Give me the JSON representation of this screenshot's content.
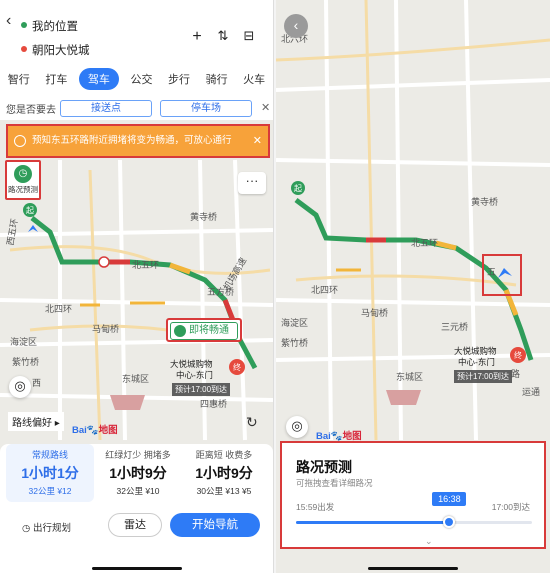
{
  "left": {
    "origin": "我的位置",
    "destination": "朝阳大悦城",
    "toolbar_icons": [
      "plus-icon",
      "swap-icon",
      "more-icon"
    ],
    "modes": [
      {
        "label": "智行",
        "active": false
      },
      {
        "label": "打车",
        "active": false
      },
      {
        "label": "驾车",
        "active": true
      },
      {
        "label": "公交",
        "active": false
      },
      {
        "label": "步行",
        "active": false
      },
      {
        "label": "骑行",
        "active": false
      },
      {
        "label": "火车",
        "active": false
      }
    ],
    "where_prompt": "您是否要去",
    "chip_pickup": "接送点",
    "chip_parking": "停车场",
    "notice": "预知东五环路附近拥堵将变为畅通，可放心通行",
    "forecast_button": "路况预测",
    "more_button": "···",
    "smooth_tag": "即将畅通",
    "eta": "预计17:00到达",
    "route_pref": "路线偏好 ▸",
    "routes": [
      {
        "tag": "常规路线",
        "time": "1小时1分",
        "sub": "32公里 ¥12",
        "selected": true
      },
      {
        "tag": "红绿灯少  拥堵多",
        "time": "1小时9分",
        "sub": "32公里 ¥10",
        "selected": false
      },
      {
        "tag": "距离短  收费多",
        "time": "1小时9分",
        "sub": "30公里 ¥13 ¥5",
        "selected": false
      }
    ],
    "plan_label": "出行规划",
    "radar_label": "雷达",
    "nav_label": "开始导航",
    "map_labels": {
      "huangsi": "黄寺桥",
      "beiwuhuan": "北五环",
      "beisihuan": "北四环",
      "maweiqiao": "马甸桥",
      "haidian": "海淀区",
      "zizhu": "紫竹桥",
      "dongcheng": "东城区",
      "jichang": "机场高速",
      "wufang": "五方桥",
      "sihui": "四惠桥",
      "mall1": "大悦城购物",
      "mall2": "中心-东门",
      "start": "起",
      "end": "终",
      "xi": "西",
      "xiwuhuan": "西五环"
    }
  },
  "right": {
    "map_labels": {
      "beiliuhuan": "北六环",
      "beiwuhuan": "北五环",
      "beisihuan": "北四环",
      "huangsi": "黄寺桥",
      "maweiqiao": "马甸桥",
      "sanyuan": "三元桥",
      "haidian": "海淀区",
      "zizhu": "紫竹桥",
      "dongcheng": "东城区",
      "start": "起",
      "end": "终",
      "mall1": "大悦城购物",
      "mall2": "中心-东门",
      "yuntong": "运通",
      "road": "路",
      "wu": "五"
    },
    "eta": "预计17:00到达",
    "forecast": {
      "title": "路况预测",
      "hint": "可拖拽查看详细路况",
      "start_label": "15:59出发",
      "end_label": "17:00到达",
      "current_time": "16:38",
      "progress": 0.65
    }
  },
  "brand": {
    "bai": "Bai",
    "du": "地图"
  },
  "colors": {
    "accent": "#2e7bf6",
    "smooth": "#2f9d5a",
    "slow": "#f2b53a",
    "jam": "#d83a3a",
    "highlight_border": "#d83a3a",
    "notice_bg": "#f7a23a"
  }
}
